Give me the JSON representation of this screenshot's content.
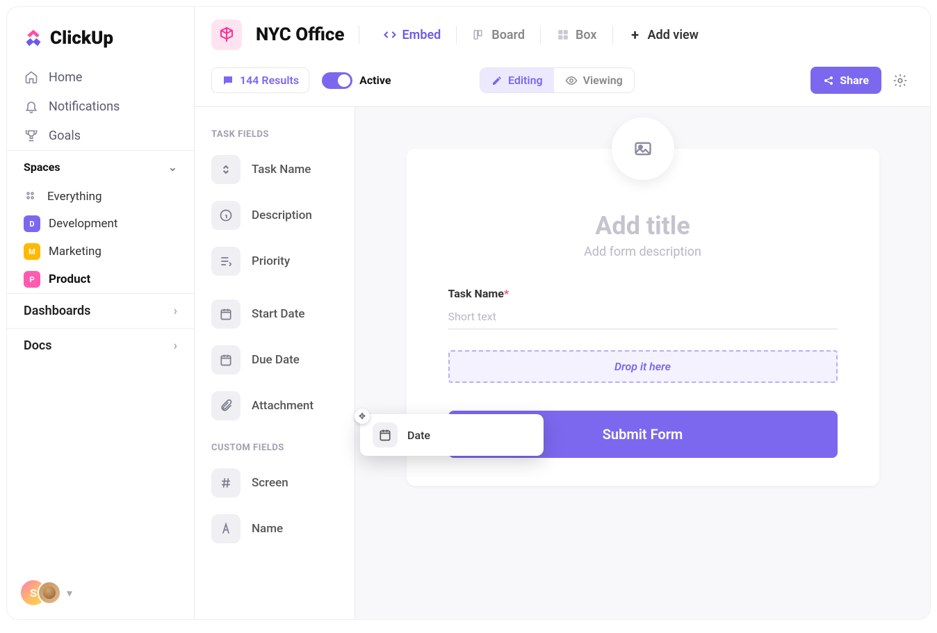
{
  "brand": "ClickUp",
  "nav": {
    "home": "Home",
    "notifications": "Notifications",
    "goals": "Goals"
  },
  "sections": {
    "spaces": "Spaces",
    "dashboards": "Dashboards",
    "docs": "Docs"
  },
  "spaces": {
    "everything": "Everything",
    "items": [
      {
        "letter": "D",
        "label": "Development",
        "color": "#7b68ee"
      },
      {
        "letter": "M",
        "label": "Marketing",
        "color": "#ffb900"
      },
      {
        "letter": "P",
        "label": "Product",
        "color": "#ff5bb0"
      }
    ]
  },
  "userInitial": "S",
  "project": {
    "name": "NYC Office"
  },
  "views": {
    "embed": "Embed",
    "board": "Board",
    "box": "Box",
    "add": "Add view"
  },
  "subbar": {
    "results_label": "144 Results",
    "active_label": "Active",
    "editing": "Editing",
    "viewing": "Viewing",
    "share": "Share"
  },
  "panel": {
    "task_fields_head": "TASK FIELDS",
    "custom_fields_head": "CUSTOM FIELDS",
    "task_name": "Task Name",
    "description": "Description",
    "priority": "Priority",
    "start_date": "Start Date",
    "due_date": "Due Date",
    "attachment": "Attachment",
    "screen": "Screen",
    "name": "Name"
  },
  "form": {
    "title_placeholder": "Add title",
    "desc_placeholder": "Add form description",
    "task_name_label": "Task Name",
    "task_name_placeholder": "Short text",
    "drop_text": "Drop it here",
    "submit": "Submit Form"
  },
  "drag": {
    "label": "Date"
  }
}
